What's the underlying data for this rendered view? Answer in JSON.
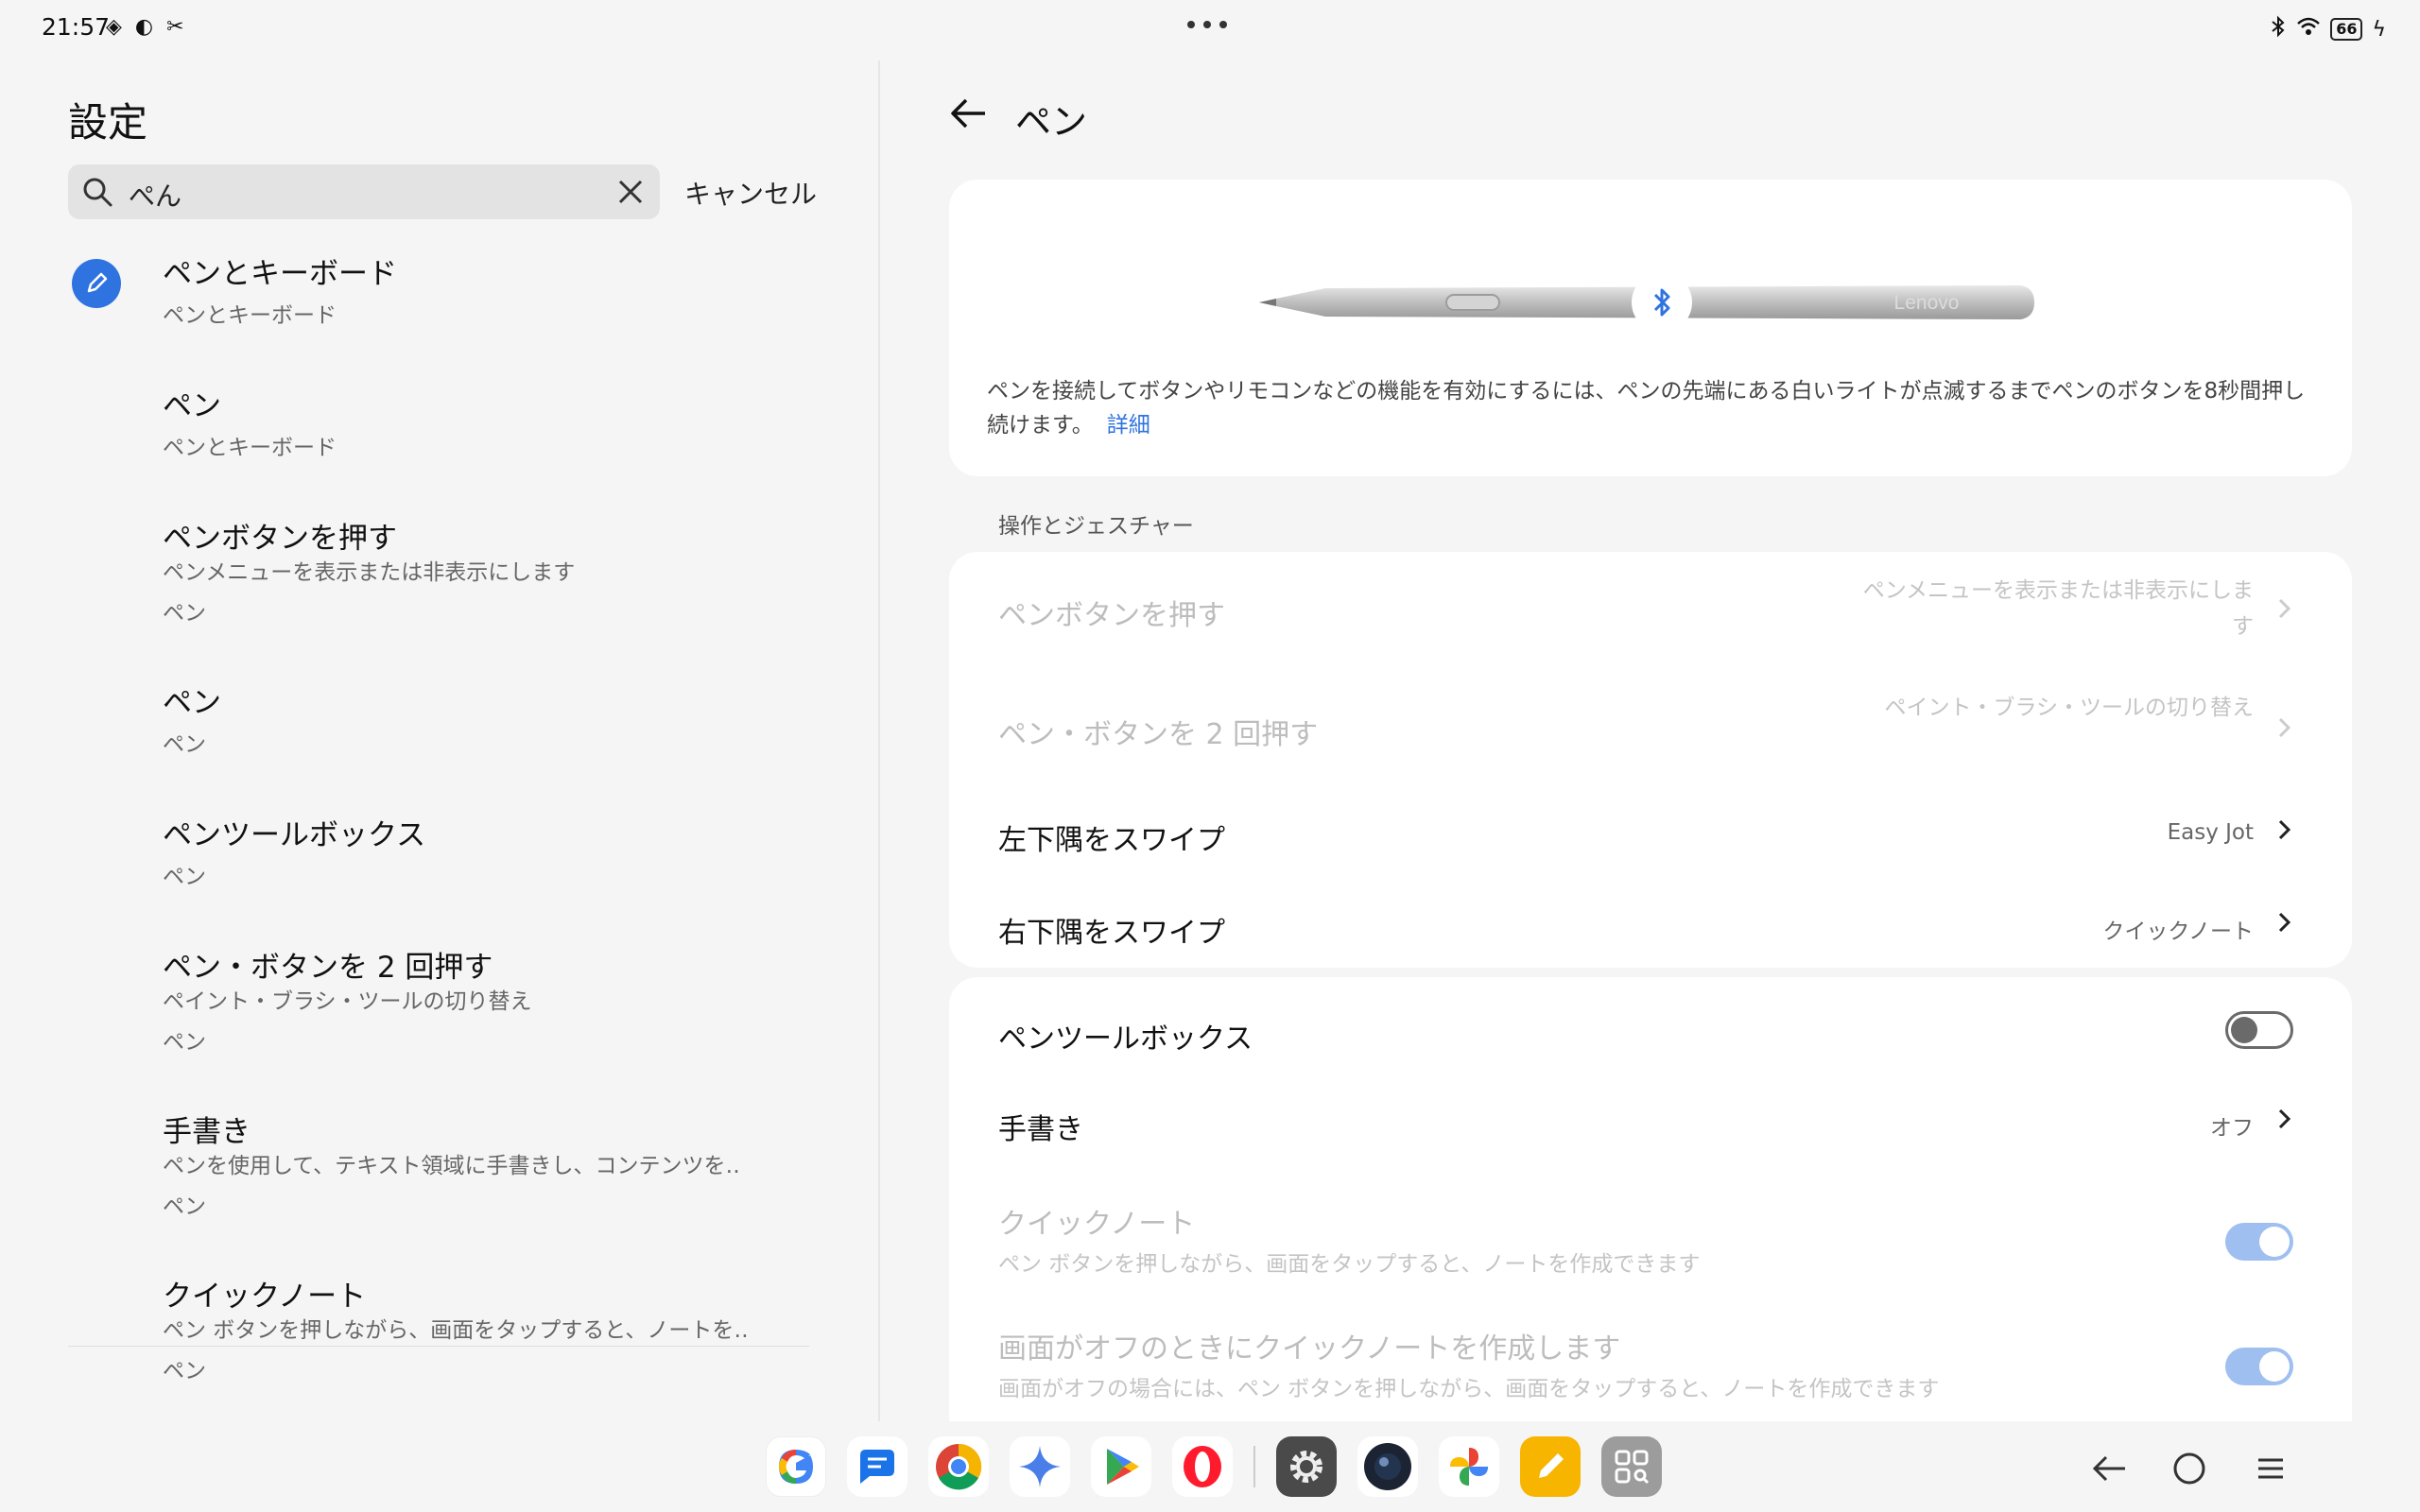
{
  "status": {
    "time": "21:57",
    "battery": "66"
  },
  "left": {
    "title": "設定",
    "search": {
      "value": "ぺん"
    },
    "cancel": "キャンセル",
    "results": [
      {
        "title": "ペンとキーボード",
        "lines": [
          "ペンとキーボード"
        ]
      },
      {
        "title": "ペン",
        "lines": [
          "ペンとキーボード"
        ]
      },
      {
        "title": "ペンボタンを押す",
        "lines": [
          "ペンメニューを表示または非表示にします",
          "ペン"
        ]
      },
      {
        "title": "ペン",
        "lines": [
          "ペン"
        ]
      },
      {
        "title": "ペンツールボックス",
        "lines": [
          "ペン"
        ]
      },
      {
        "title": "ペン・ボタンを 2 回押す",
        "lines": [
          "ペイント・ブラシ・ツールの切り替え",
          "ペン"
        ]
      },
      {
        "title": "手書き",
        "lines": [
          "ペンを使用して、テキスト領域に手書きし、コンテンツを‥",
          "ペン"
        ]
      },
      {
        "title": "クイックノート",
        "lines": [
          "ペン ボタンを押しながら、画面をタップすると、ノートを‥",
          "ペン"
        ]
      }
    ]
  },
  "right": {
    "title": "ペン",
    "pen_card": {
      "brand": "Lenovo",
      "description": "ペンを接続してボタンやリモコンなどの機能を有効にするには、ペンの先端にある白いライトが点滅するまでペンのボタンを8秒間押し続けます。",
      "link": "詳細"
    },
    "section_label": "操作とジェスチャー",
    "gestures": [
      {
        "label": "ペンボタンを押す",
        "value": "ペンメニューを表示または非表示にします",
        "disabled": true
      },
      {
        "label": "ペン・ボタンを 2 回押す",
        "value": "ペイント・ブラシ・ツールの切り替え",
        "disabled": true
      },
      {
        "label": "左下隅をスワイプ",
        "value": "Easy Jot",
        "disabled": false
      },
      {
        "label": "右下隅をスワイプ",
        "value": "クイックノート",
        "disabled": false
      }
    ],
    "tools": [
      {
        "label": "ペンツールボックス",
        "toggle": "off"
      },
      {
        "label": "手書き",
        "value": "オフ"
      },
      {
        "label": "クイックノート",
        "sub": "ペン ボタンを押しながら、画面をタップすると、ノートを作成できます",
        "toggle": "on",
        "disabled": true
      },
      {
        "label": "画面がオフのときにクイックノートを作成します",
        "sub": "画面がオフの場合には、ペン ボタンを押しながら、画面をタップすると、ノートを作成できます",
        "toggle": "on",
        "disabled": true
      }
    ]
  },
  "taskbar": {
    "apps": [
      "google-app-icon",
      "messages-app-icon",
      "chrome-app-icon",
      "gemini-app-icon",
      "play-store-app-icon",
      "opera-app-icon",
      "settings-app-icon",
      "camera-app-icon",
      "photos-app-icon",
      "notes-app-icon",
      "app-library-icon"
    ],
    "nav": [
      "back-nav-icon",
      "home-nav-icon",
      "recents-nav-icon"
    ]
  },
  "colors": {
    "accent": "#2f73e0",
    "background": "#f5f5f5",
    "card": "#ffffff",
    "disabled_text": "#bdbdbd"
  }
}
